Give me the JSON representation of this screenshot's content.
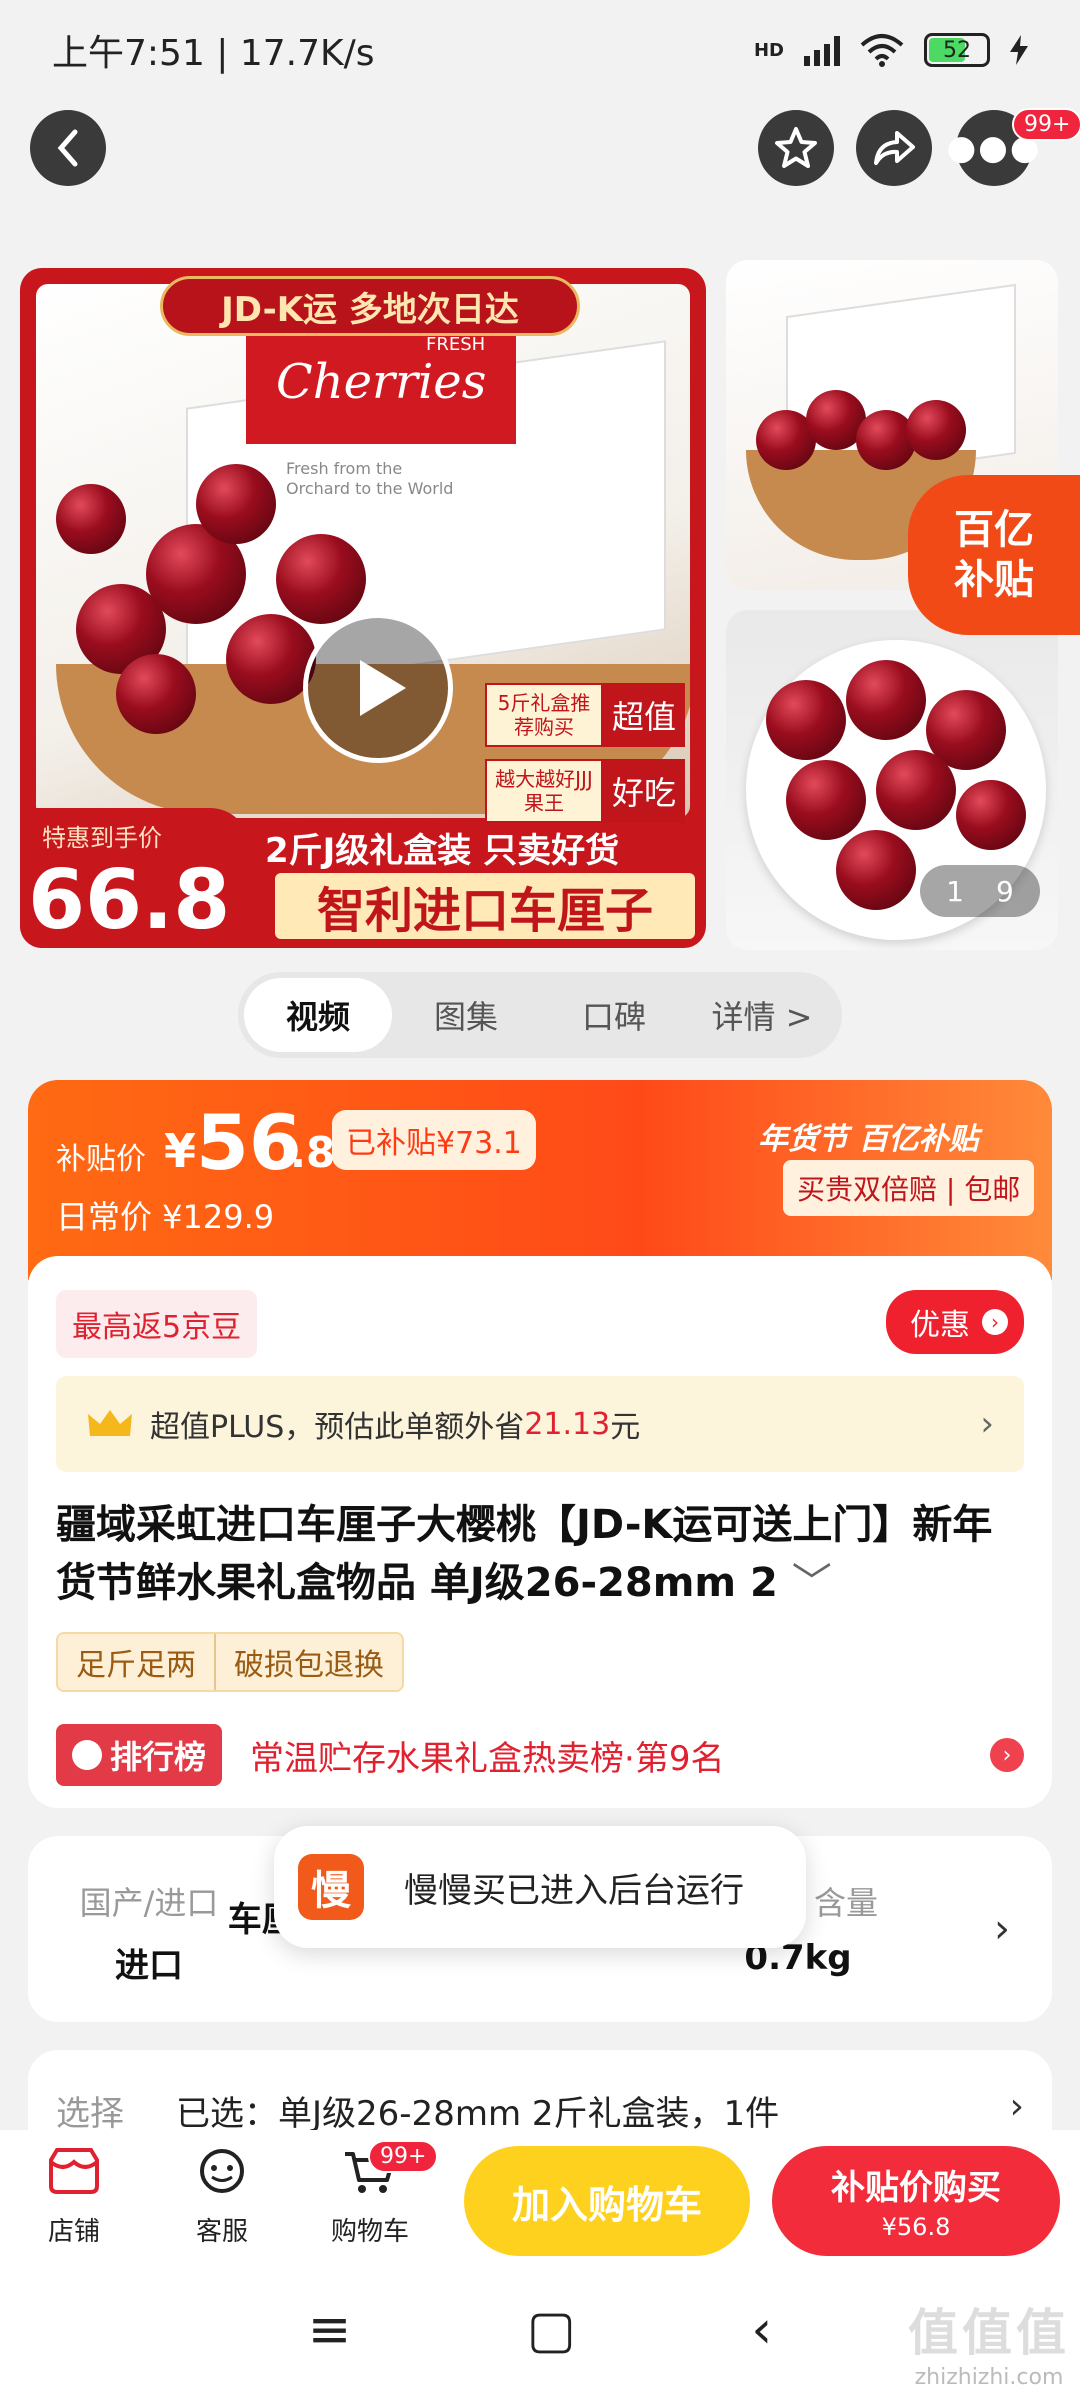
{
  "status_bar": {
    "time": "上午7:51 | 17.7K/s",
    "battery": "52",
    "network": "HD"
  },
  "top_nav": {
    "badge": "99+"
  },
  "gallery": {
    "banner_top": "JD-K运  多地次日达",
    "box_brand": "Cherries",
    "box_fresh": "FRESH",
    "box_sub": "Fresh from the Orchard to the World",
    "tag1_left": "5斤礼盒推荐购买",
    "tag1_right": "超值",
    "tag2_left": "越大越好JJJ果王",
    "tag2_right": "好吃",
    "price_label": "特惠到手价",
    "price_value": "66.8",
    "ribbon_top": "2斤J级礼盒装  只卖好货",
    "ribbon_main": "智利进口车厘子",
    "subsidy_badge_line1": "百亿",
    "subsidy_badge_line2": "补贴",
    "counter_current": "1",
    "counter_total": "9"
  },
  "media_tabs": [
    {
      "label": "视频",
      "active": true
    },
    {
      "label": "图集",
      "active": false
    },
    {
      "label": "口碑",
      "active": false
    },
    {
      "label": "详情 >",
      "active": false
    }
  ],
  "price": {
    "label": "补贴价",
    "yen": "¥",
    "main": "56",
    "decimal": ".8",
    "subsidized": "已补贴¥73.1",
    "daily_price": "日常价 ¥129.9",
    "right_top": "年货节  百亿补贴",
    "right_bottom": "买贵双倍赔 | 包邮"
  },
  "info": {
    "jd_bean": "最高返5京豆",
    "discount": "优惠",
    "plus_prefix": "超值PLUS，预估此单额外省",
    "plus_amount": "21.13",
    "plus_suffix": "元",
    "title": "疆域采虹进口车厘子大樱桃【JD-K运可送上门】新年货节鲜水果礼盒物品 单J级26-28mm 2",
    "chip1": "足斤足两",
    "chip2": "破损包退换",
    "rank_badge": "排行榜",
    "rank_text": "常温贮存水果礼盒热卖榜·第9名"
  },
  "specs": [
    {
      "label": "国产/进口",
      "value": "进口"
    },
    {
      "label": "",
      "value": "车厘子/樱桃礼盒"
    },
    {
      "label": "含量",
      "value": "0.7kg"
    }
  ],
  "toast": {
    "icon_text": "慢",
    "text": "慢慢买已进入后台运行"
  },
  "select": {
    "label": "选择",
    "value": "已选：单J级26-28mm 2斤礼盒装，1件"
  },
  "bottom_bar": {
    "store": "店铺",
    "service": "客服",
    "cart": "购物车",
    "cart_badge": "99+",
    "add_to_cart": "加入购物车",
    "buy_label": "补贴价购买",
    "buy_price": "¥56.8"
  },
  "watermark": {
    "line1": "值值值",
    "line2": "zhizhizhi.com"
  },
  "colors": {
    "accent": "#f22c3a",
    "orange": "#ff6a13",
    "yellow": "#ffd11f"
  }
}
